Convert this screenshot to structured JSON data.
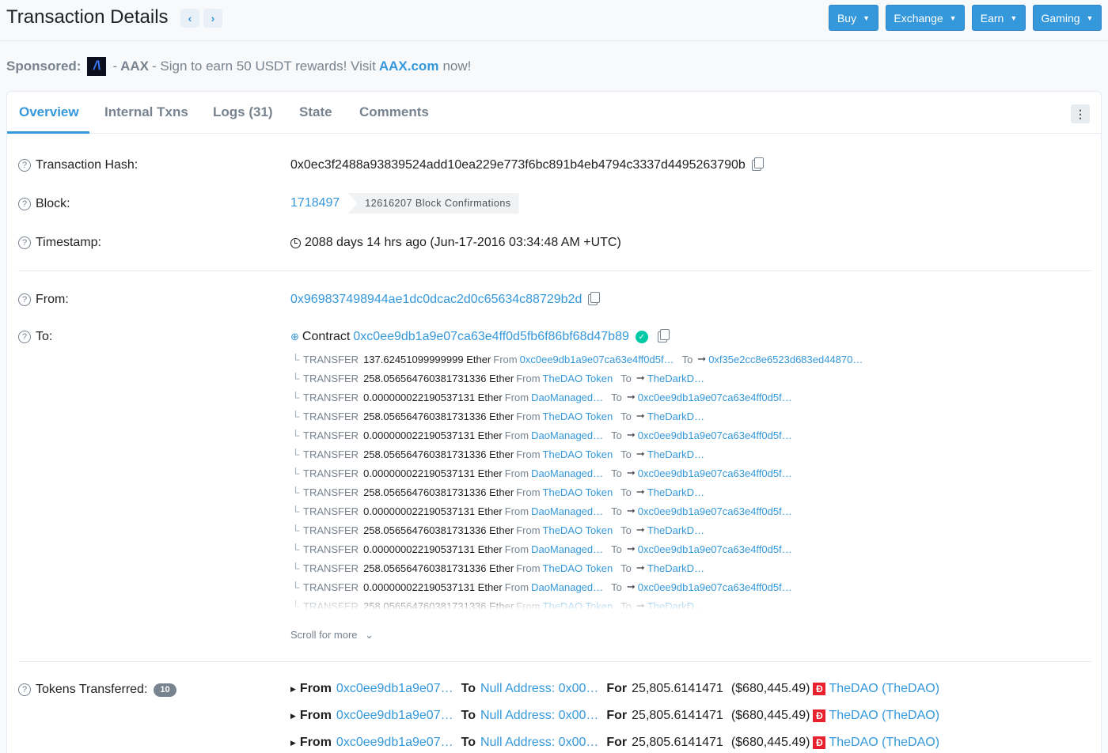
{
  "header": {
    "title": "Transaction Details",
    "prev_label": "‹",
    "next_label": "›",
    "buttons": [
      {
        "label": "Buy"
      },
      {
        "label": "Exchange"
      },
      {
        "label": "Earn"
      },
      {
        "label": "Gaming"
      }
    ]
  },
  "sponsored": {
    "label": "Sponsored:",
    "brand": "AAX",
    "text": "- Sign to earn 50 USDT rewards! Visit",
    "link": "AAX.com",
    "suffix": "now!"
  },
  "tabs": [
    {
      "label": "Overview",
      "active": true
    },
    {
      "label": "Internal Txns"
    },
    {
      "label": "Logs (31)"
    },
    {
      "label": "State"
    },
    {
      "label": "Comments"
    }
  ],
  "overview": {
    "tx_hash_label": "Transaction Hash:",
    "tx_hash": "0x0ec3f2488a93839524add10ea229e773f6bc891b4eb4794c3337d4495263790b",
    "block_label": "Block:",
    "block": "1718497",
    "confirmations": "12616207 Block Confirmations",
    "timestamp_label": "Timestamp:",
    "timestamp": "2088 days 14 hrs ago (Jun-17-2016 03:34:48 AM +UTC)",
    "from_label": "From:",
    "from": "0x969837498944ae1dc0dcac2d0c65634c88729b2d",
    "to_label": "To:",
    "to_prefix": "Contract",
    "to": "0xc0ee9db1a9e07ca63e4ff0d5fb6f86bf68d47b89",
    "scroll_more": "Scroll for more",
    "tokens_label": "Tokens Transferred:",
    "tokens_count": "10"
  },
  "transfers": [
    {
      "type": "TRANSFER",
      "amount": "137.62451099999999 Ether",
      "from": "0xc0ee9db1a9e07ca63e4ff0d5f…",
      "to": "0xf35e2cc8e6523d683ed44870…"
    },
    {
      "type": "TRANSFER",
      "amount": "258.056564760381731336 Ether",
      "from": "TheDAO Token",
      "to": "TheDarkD…"
    },
    {
      "type": "TRANSFER",
      "amount": "0.000000022190537131 Ether",
      "from": "DaoManaged…",
      "to": "0xc0ee9db1a9e07ca63e4ff0d5f…"
    },
    {
      "type": "TRANSFER",
      "amount": "258.056564760381731336 Ether",
      "from": "TheDAO Token",
      "to": "TheDarkD…"
    },
    {
      "type": "TRANSFER",
      "amount": "0.000000022190537131 Ether",
      "from": "DaoManaged…",
      "to": "0xc0ee9db1a9e07ca63e4ff0d5f…"
    },
    {
      "type": "TRANSFER",
      "amount": "258.056564760381731336 Ether",
      "from": "TheDAO Token",
      "to": "TheDarkD…"
    },
    {
      "type": "TRANSFER",
      "amount": "0.000000022190537131 Ether",
      "from": "DaoManaged…",
      "to": "0xc0ee9db1a9e07ca63e4ff0d5f…"
    },
    {
      "type": "TRANSFER",
      "amount": "258.056564760381731336 Ether",
      "from": "TheDAO Token",
      "to": "TheDarkD…"
    },
    {
      "type": "TRANSFER",
      "amount": "0.000000022190537131 Ether",
      "from": "DaoManaged…",
      "to": "0xc0ee9db1a9e07ca63e4ff0d5f…"
    },
    {
      "type": "TRANSFER",
      "amount": "258.056564760381731336 Ether",
      "from": "TheDAO Token",
      "to": "TheDarkD…"
    },
    {
      "type": "TRANSFER",
      "amount": "0.000000022190537131 Ether",
      "from": "DaoManaged…",
      "to": "0xc0ee9db1a9e07ca63e4ff0d5f…"
    },
    {
      "type": "TRANSFER",
      "amount": "258.056564760381731336 Ether",
      "from": "TheDAO Token",
      "to": "TheDarkD…"
    },
    {
      "type": "TRANSFER",
      "amount": "0.000000022190537131 Ether",
      "from": "DaoManaged…",
      "to": "0xc0ee9db1a9e07ca63e4ff0d5f…"
    },
    {
      "type": "TRANSFER",
      "amount": "258.056564760381731336 Ether",
      "from": "TheDAO Token",
      "to": "TheDarkD…"
    }
  ],
  "token_transfers": [
    {
      "from_label": "From",
      "from": "0xc0ee9db1a9e07…",
      "to_label": "To",
      "to": "Null Address: 0x00…",
      "for_label": "For",
      "amount": "25,805.6141471",
      "usd": "($680,445.49)",
      "token": "TheDAO (TheDAO)"
    },
    {
      "from_label": "From",
      "from": "0xc0ee9db1a9e07…",
      "to_label": "To",
      "to": "Null Address: 0x00…",
      "for_label": "For",
      "amount": "25,805.6141471",
      "usd": "($680,445.49)",
      "token": "TheDAO (TheDAO)"
    },
    {
      "from_label": "From",
      "from": "0xc0ee9db1a9e07…",
      "to_label": "To",
      "to": "Null Address: 0x00…",
      "for_label": "For",
      "amount": "25,805.6141471",
      "usd": "($680,445.49)",
      "token": "TheDAO (TheDAO)"
    }
  ],
  "labels": {
    "from_word": "From",
    "to_word": "To"
  },
  "icons": {
    "help": "question-circle-icon",
    "copy": "copy-icon",
    "clock": "clock-icon",
    "verified": "check-circle-icon",
    "token": "thedao-token-icon"
  },
  "colors": {
    "accent": "#3498db",
    "verified": "#00c9a7",
    "token_red": "#e8212e",
    "muted": "#77838f"
  }
}
